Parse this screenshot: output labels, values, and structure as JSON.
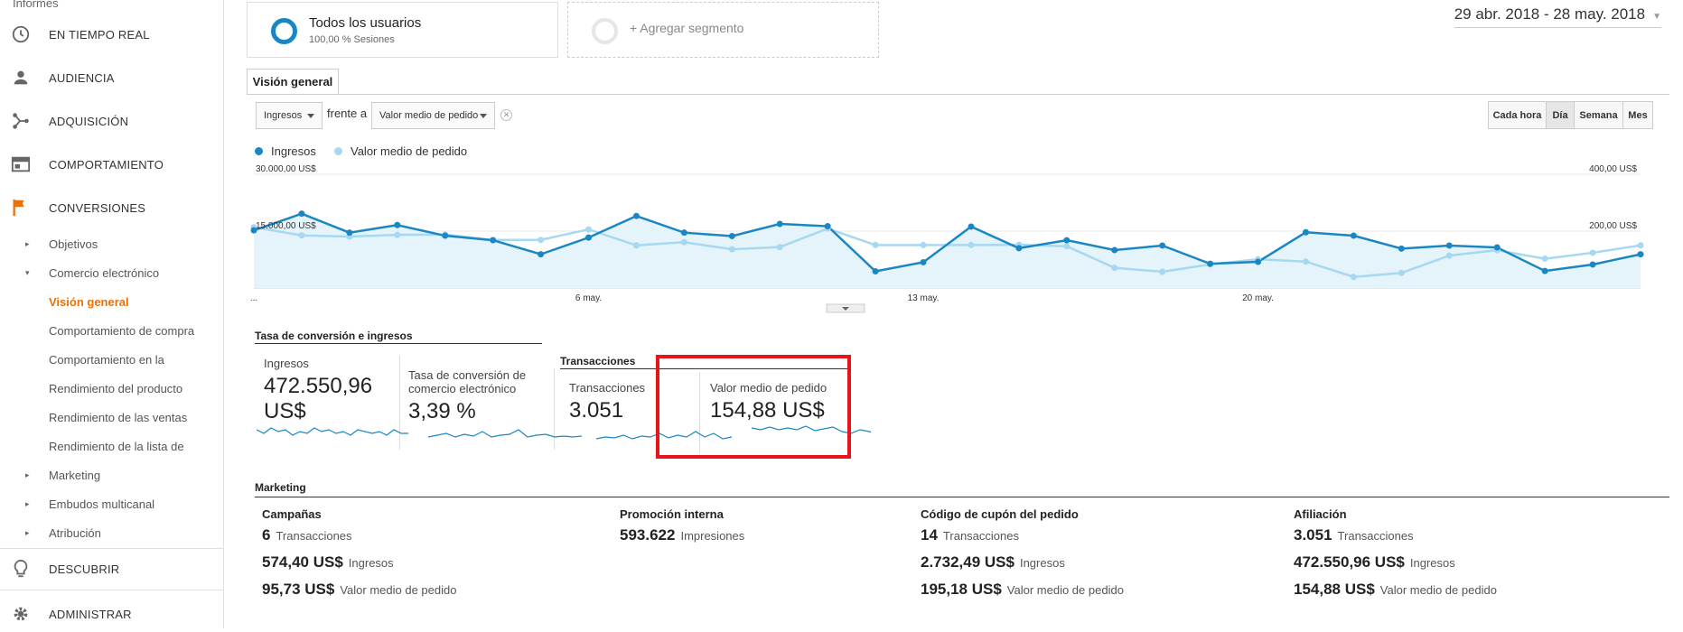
{
  "sidebar": {
    "reports_label": "Informes",
    "main_items": [
      {
        "label": "EN TIEMPO REAL",
        "icon": "clock-icon"
      },
      {
        "label": "AUDIENCIA",
        "icon": "person-icon"
      },
      {
        "label": "ADQUISICIÓN",
        "icon": "acquisition-icon"
      },
      {
        "label": "COMPORTAMIENTO",
        "icon": "behavior-icon"
      },
      {
        "label": "CONVERSIONES",
        "icon": "flag-icon"
      }
    ],
    "sub_items": [
      {
        "label": "Objetivos",
        "caret": "▸"
      },
      {
        "label": "Comercio electrónico",
        "caret": "▾"
      },
      {
        "label": "Visión general",
        "caret": ""
      },
      {
        "label": "Comportamiento de compra",
        "caret": ""
      },
      {
        "label": "Comportamiento en la",
        "caret": ""
      },
      {
        "label": "Rendimiento del producto",
        "caret": ""
      },
      {
        "label": "Rendimiento de las ventas",
        "caret": ""
      },
      {
        "label": "Rendimiento de la lista de",
        "caret": ""
      },
      {
        "label": "Marketing",
        "caret": "▸"
      },
      {
        "label": "Embudos multicanal",
        "caret": "▸"
      },
      {
        "label": "Atribución",
        "caret": "▸"
      }
    ],
    "bottom_items": [
      {
        "label": "DESCUBRIR",
        "icon": "lightbulb-icon"
      },
      {
        "label": "ADMINISTRAR",
        "icon": "gear-icon"
      }
    ]
  },
  "segments": {
    "all_users_title": "Todos los usuarios",
    "all_users_sub": "100,00 % Sesiones",
    "add_segment": "+ Agregar segmento"
  },
  "date_range": "29 abr. 2018 - 28 may. 2018",
  "tab": "Visión general",
  "controls": {
    "metric1": "Ingresos",
    "versus": "frente a",
    "metric2": "Valor medio de pedido",
    "granularity": [
      "Cada hora",
      "Día",
      "Semana",
      "Mes"
    ]
  },
  "colors": {
    "series1": "#1a87c4",
    "series2": "#a6d8ef",
    "fill": "#e5f3fa",
    "highlight": "#e8141b",
    "accent": "#e8710a"
  },
  "chart_data": {
    "type": "line",
    "series": [
      {
        "name": "Ingresos",
        "axis": "left",
        "values": [
          15200,
          19600,
          14600,
          16600,
          13800,
          12600,
          8900,
          13300,
          19000,
          14600,
          13700,
          16900,
          16300,
          4400,
          6800,
          16200,
          10500,
          12600,
          10000,
          11200,
          6400,
          6900,
          14700,
          13800,
          10400,
          11200,
          10700,
          4500,
          6200,
          8900
        ]
      },
      {
        "name": "Valor medio de pedido",
        "axis": "right",
        "values": [
          214,
          185,
          181,
          187,
          188,
          169,
          169,
          206,
          150,
          161,
          136,
          144,
          209,
          151,
          151,
          151,
          152,
          147,
          71,
          57,
          83,
          101,
          93,
          39,
          53,
          114,
          133,
          103,
          124,
          150
        ]
      }
    ],
    "left_ticks": [
      "30.000,00 US$",
      "15.000,00 US$"
    ],
    "right_ticks": [
      "400,00 US$",
      "200,00 US$"
    ],
    "left_ylim": [
      0,
      30000
    ],
    "right_ylim": [
      0,
      400
    ],
    "x_labels": [
      "...",
      "6 may.",
      "13 may.",
      "20 may."
    ]
  },
  "summary": {
    "section1_title": "Tasa de conversión e ingresos",
    "section2_title": "Transacciones",
    "metrics": [
      {
        "name": "Ingresos",
        "value": "472.550,96 US$"
      },
      {
        "name": "Tasa de conversión de comercio electrónico",
        "value": "3,39 %"
      },
      {
        "name": "Transacciones",
        "value": "3.051"
      },
      {
        "name": "Valor medio de pedido",
        "value": "154,88 US$"
      }
    ]
  },
  "marketing": {
    "title": "Marketing",
    "columns": [
      {
        "head": "Campañas",
        "rows": [
          {
            "num": "6",
            "unit": "Transacciones"
          },
          {
            "num": "574,40 US$",
            "unit": "Ingresos"
          },
          {
            "num": "95,73 US$",
            "unit": "Valor medio de pedido"
          }
        ]
      },
      {
        "head": "Promoción interna",
        "rows": [
          {
            "num": "593.622",
            "unit": "Impresiones"
          }
        ]
      },
      {
        "head": "Código de cupón del pedido",
        "rows": [
          {
            "num": "14",
            "unit": "Transacciones"
          },
          {
            "num": "2.732,49 US$",
            "unit": "Ingresos"
          },
          {
            "num": "195,18 US$",
            "unit": "Valor medio de pedido"
          }
        ]
      },
      {
        "head": "Afiliación",
        "rows": [
          {
            "num": "3.051",
            "unit": "Transacciones"
          },
          {
            "num": "472.550,96 US$",
            "unit": "Ingresos"
          },
          {
            "num": "154,88 US$",
            "unit": "Valor medio de pedido"
          }
        ]
      }
    ]
  }
}
